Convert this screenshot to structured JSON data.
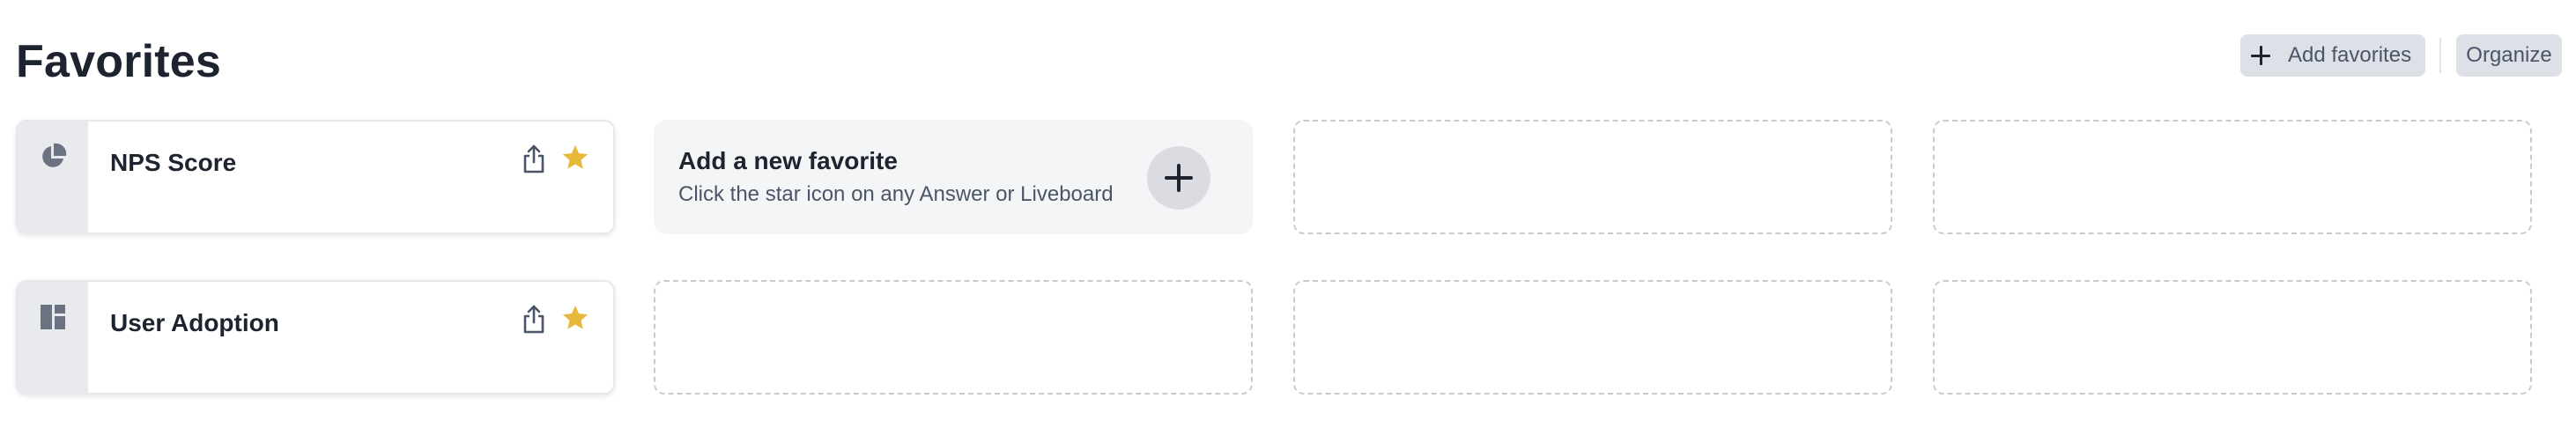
{
  "header": {
    "title": "Favorites",
    "add_favorites_label": "Add favorites",
    "organize_label": "Organize"
  },
  "favorites": [
    {
      "name": "NPS Score",
      "type_icon": "pie-chart-icon",
      "starred": true
    },
    {
      "name": "User Adoption",
      "type_icon": "liveboard-icon",
      "starred": true
    }
  ],
  "add_card": {
    "title": "Add a new favorite",
    "subtitle": "Click the star icon on any Answer or Liveboard"
  },
  "colors": {
    "star": "#e8b83a",
    "accent_bg": "#dde0e6",
    "text": "#1d232f"
  }
}
